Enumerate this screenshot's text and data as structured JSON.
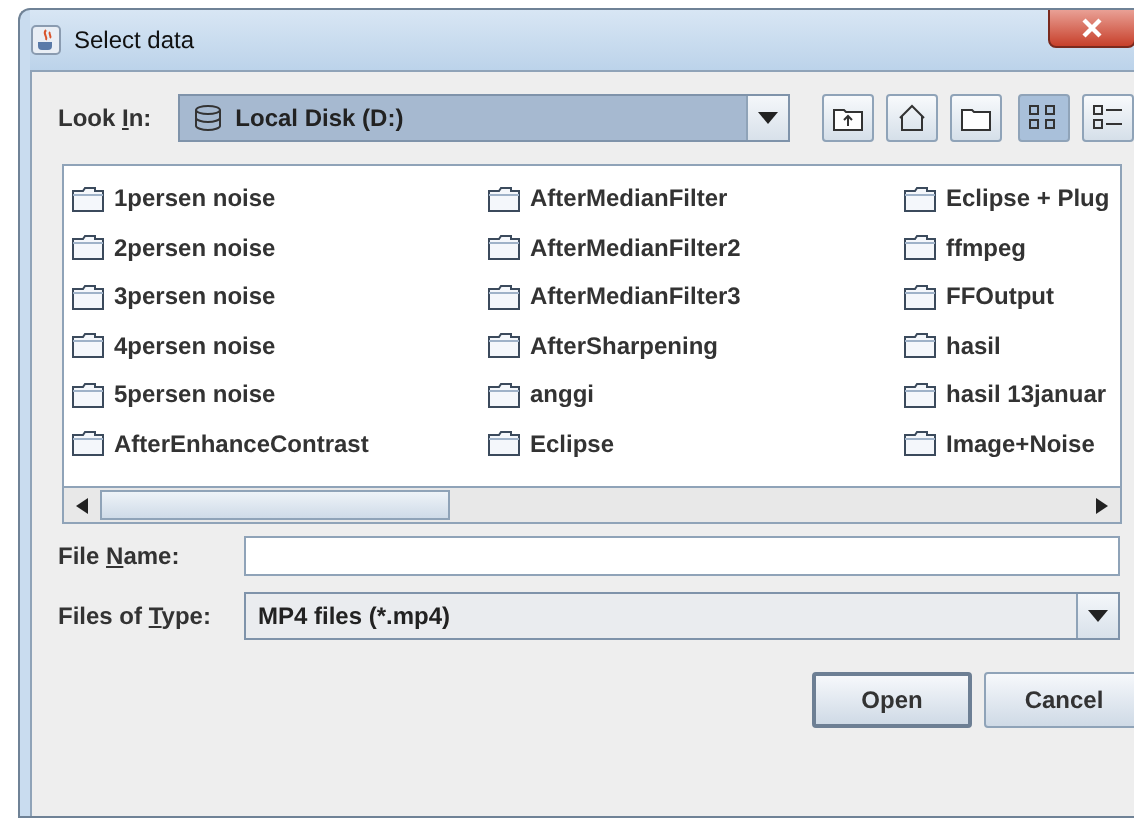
{
  "window": {
    "title": "Select data"
  },
  "look_in": {
    "label": {
      "before": "Look ",
      "key": "I",
      "after": "n:"
    },
    "value": "Local Disk (D:)"
  },
  "toolbar": [
    {
      "kind": "up"
    },
    {
      "kind": "home"
    },
    {
      "kind": "new-folder"
    },
    {
      "kind": "list",
      "selected": true
    },
    {
      "kind": "details",
      "selected": false
    }
  ],
  "files": [
    [
      "1persen noise",
      "2persen noise",
      "3persen noise",
      "4persen noise",
      "5persen noise",
      "AfterEnhanceContrast"
    ],
    [
      "AfterMedianFilter",
      "AfterMedianFilter2",
      "AfterMedianFilter3",
      "AfterSharpening",
      "anggi",
      "Eclipse"
    ],
    [
      "Eclipse + Plug",
      "ffmpeg",
      "FFOutput",
      "hasil",
      "hasil 13januar",
      "Image+Noise"
    ]
  ],
  "file_name": {
    "label": {
      "before": "File ",
      "key": "N",
      "after": "ame:"
    }
  },
  "file_type": {
    "label": {
      "before": "Files of ",
      "key": "T",
      "after": "ype:"
    },
    "value": "MP4 files (*.mp4)"
  },
  "buttons": [
    "Open",
    "Cancel"
  ]
}
